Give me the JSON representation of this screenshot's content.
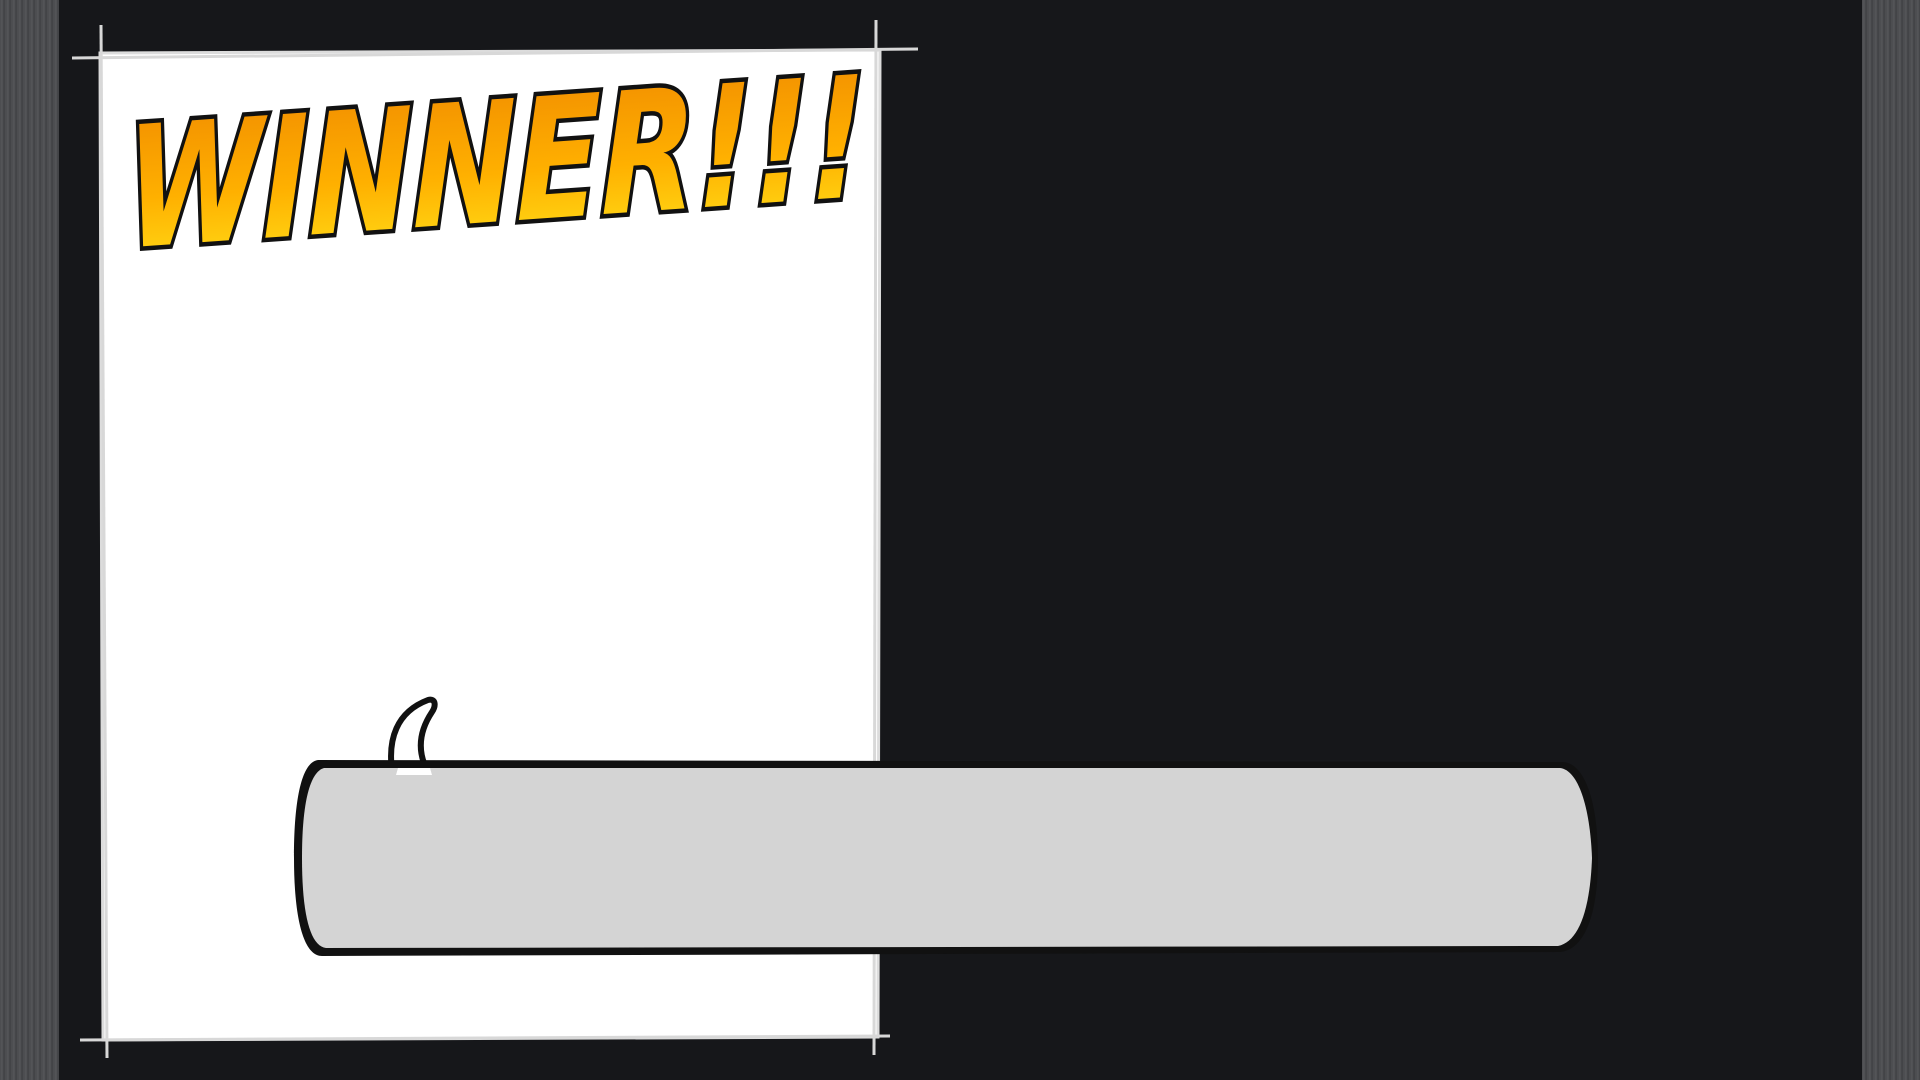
{
  "screen": {
    "title_text": "WINNER!!!",
    "dialog_text": ""
  },
  "colors": {
    "background": "#16171a",
    "panel": "#ffffff",
    "dialog_fill": "#d4d4d4",
    "outline": "#111111",
    "title_top": "#f08a00",
    "title_bottom": "#ffe21a",
    "side_bars": "#4e4f52"
  }
}
